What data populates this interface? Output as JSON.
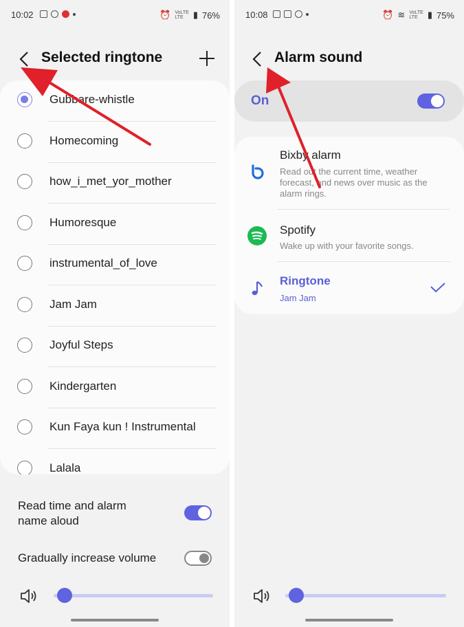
{
  "left": {
    "status": {
      "time": "10:02",
      "battery": "76%",
      "net1": "VoLTE",
      "net2": "LTE"
    },
    "header": {
      "title": "Selected ringtone"
    },
    "ringtones": [
      {
        "label": "Gubbare-whistle",
        "checked": true
      },
      {
        "label": "Homecoming",
        "checked": false
      },
      {
        "label": "how_i_met_yor_mother",
        "checked": false
      },
      {
        "label": "Humoresque",
        "checked": false
      },
      {
        "label": "instrumental_of_love",
        "checked": false
      },
      {
        "label": "Jam Jam",
        "checked": false
      },
      {
        "label": "Joyful Steps",
        "checked": false
      },
      {
        "label": "Kindergarten",
        "checked": false
      },
      {
        "label": "Kun Faya kun ! Instrumental",
        "checked": false
      },
      {
        "label": "Lalala",
        "checked": false
      }
    ],
    "settings": {
      "read_aloud_line1": "Read time and alarm",
      "read_aloud_line2": "name aloud",
      "read_aloud_on": true,
      "gradual": "Gradually increase volume",
      "gradual_on": false
    },
    "volume_level": 0.07
  },
  "right": {
    "status": {
      "time": "10:08",
      "battery": "75%",
      "net1": "VoLTE",
      "net2": "LTE"
    },
    "header": {
      "title": "Alarm sound"
    },
    "master": {
      "label": "On",
      "on": true
    },
    "options": {
      "bixby": {
        "title": "Bixby alarm",
        "subtitle": "Read out the current time, weather forecast, and news over music as the alarm rings."
      },
      "spotify": {
        "title": "Spotify",
        "subtitle": "Wake up with your favorite songs."
      },
      "ringtone": {
        "title": "Ringtone",
        "subtitle": "Jam Jam",
        "selected": true
      }
    },
    "volume_level": 0.07
  },
  "colors": {
    "accent": "#5f63e0",
    "annotation": "#e0202a",
    "spotify": "#1db954",
    "bixby": "#1e6fd9"
  }
}
